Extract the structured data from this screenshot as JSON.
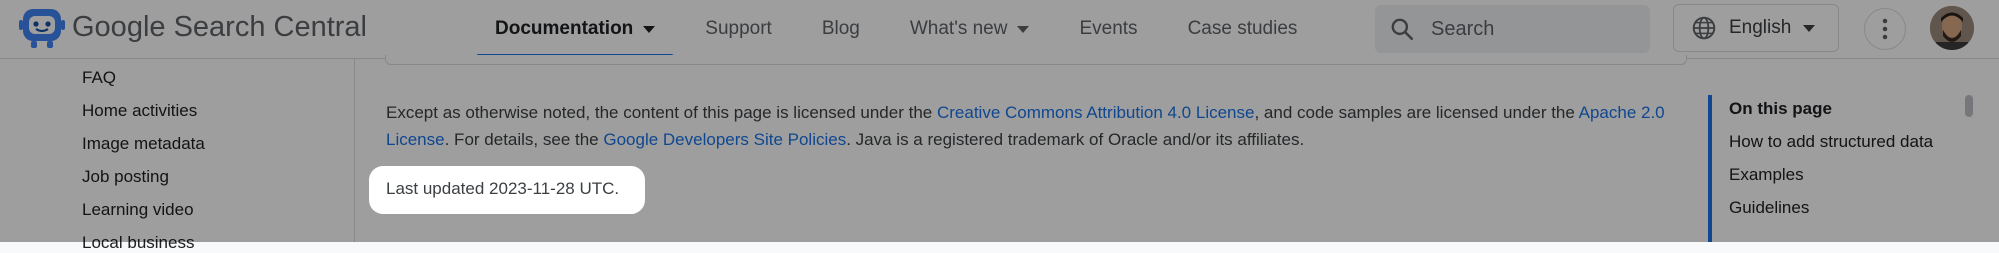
{
  "header": {
    "brand": "Google Search Central",
    "nav": [
      {
        "label": "Documentation",
        "has_menu": true,
        "active": true
      },
      {
        "label": "Support",
        "has_menu": false,
        "active": false
      },
      {
        "label": "Blog",
        "has_menu": false,
        "active": false
      },
      {
        "label": "What's new",
        "has_menu": true,
        "active": false
      },
      {
        "label": "Events",
        "has_menu": false,
        "active": false
      },
      {
        "label": "Case studies",
        "has_menu": false,
        "active": false
      }
    ],
    "search_placeholder": "Search",
    "language": "English",
    "icons": {
      "logo": "search-central-robot-icon",
      "search": "search-icon",
      "language": "globe-icon",
      "more": "more-vert-icon",
      "avatar": "user-avatar"
    }
  },
  "left_nav": {
    "items": [
      "FAQ",
      "Home activities",
      "Image metadata",
      "Job posting",
      "Learning video",
      "Local business"
    ]
  },
  "main": {
    "license": {
      "before_cc": "Except as otherwise noted, the content of this page is licensed under the ",
      "cc_link": "Creative Commons Attribution 4.0 License",
      "between": ", and code samples are licensed under the ",
      "apache_link": "Apache 2.0 License",
      "before_policies": ". For details, see the ",
      "policies_link": "Google Developers Site Policies",
      "after": ". Java is a registered trademark of Oracle and/or its affiliates."
    },
    "last_updated": "Last updated 2023-11-28 UTC."
  },
  "toc": {
    "title": "On this page",
    "items": [
      "How to add structured data",
      "Examples",
      "Guidelines"
    ]
  },
  "colors": {
    "accent": "#1a73e8",
    "overlay": "rgba(0,0,0,0.38)",
    "highlight": "#ffffff"
  }
}
